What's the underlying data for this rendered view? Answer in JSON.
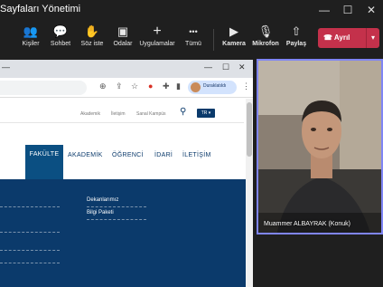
{
  "window": {
    "title": "Sayfaları Yönetimi"
  },
  "toolbar": {
    "items": [
      {
        "label": "Kişiler",
        "icon": "people-icon",
        "glyph": "👥"
      },
      {
        "label": "Sohbet",
        "icon": "chat-icon",
        "glyph": "💬"
      },
      {
        "label": "Söz iste",
        "icon": "raise-hand-icon",
        "glyph": "✋"
      },
      {
        "label": "Odalar",
        "icon": "rooms-icon",
        "glyph": "▣"
      },
      {
        "label": "Uygulamalar",
        "icon": "plus-icon",
        "glyph": "+"
      },
      {
        "label": "Tümü",
        "icon": "more-icon",
        "glyph": "•••"
      },
      {
        "label": "Kamera",
        "icon": "camera-icon",
        "glyph": "▶"
      },
      {
        "label": "Mikrofon",
        "icon": "microphone-icon",
        "glyph": "🎙"
      },
      {
        "label": "Paylaş",
        "icon": "share-icon",
        "glyph": "⇧"
      }
    ],
    "leave_label": "Ayrıl",
    "leave_color": "#c4314b"
  },
  "browser": {
    "profile_label": "Duraklatıldı",
    "site": {
      "top_links": [
        "Akademik",
        "İletişim",
        "Sanal Kampüs"
      ],
      "lang": "TR",
      "nav": [
        "FAKÜLTE",
        "AKADEMİK",
        "ÖĞRENCİ",
        "İDARİ",
        "İLETİŞİM"
      ],
      "banner_links": [
        "Dekanlarımız",
        "Bilgi Paketi"
      ],
      "brand_color": "#0b3a6b"
    }
  },
  "video": {
    "participant": "Muammer ALBAYRAK (Konuk)",
    "border_color": "#7f85f5"
  }
}
